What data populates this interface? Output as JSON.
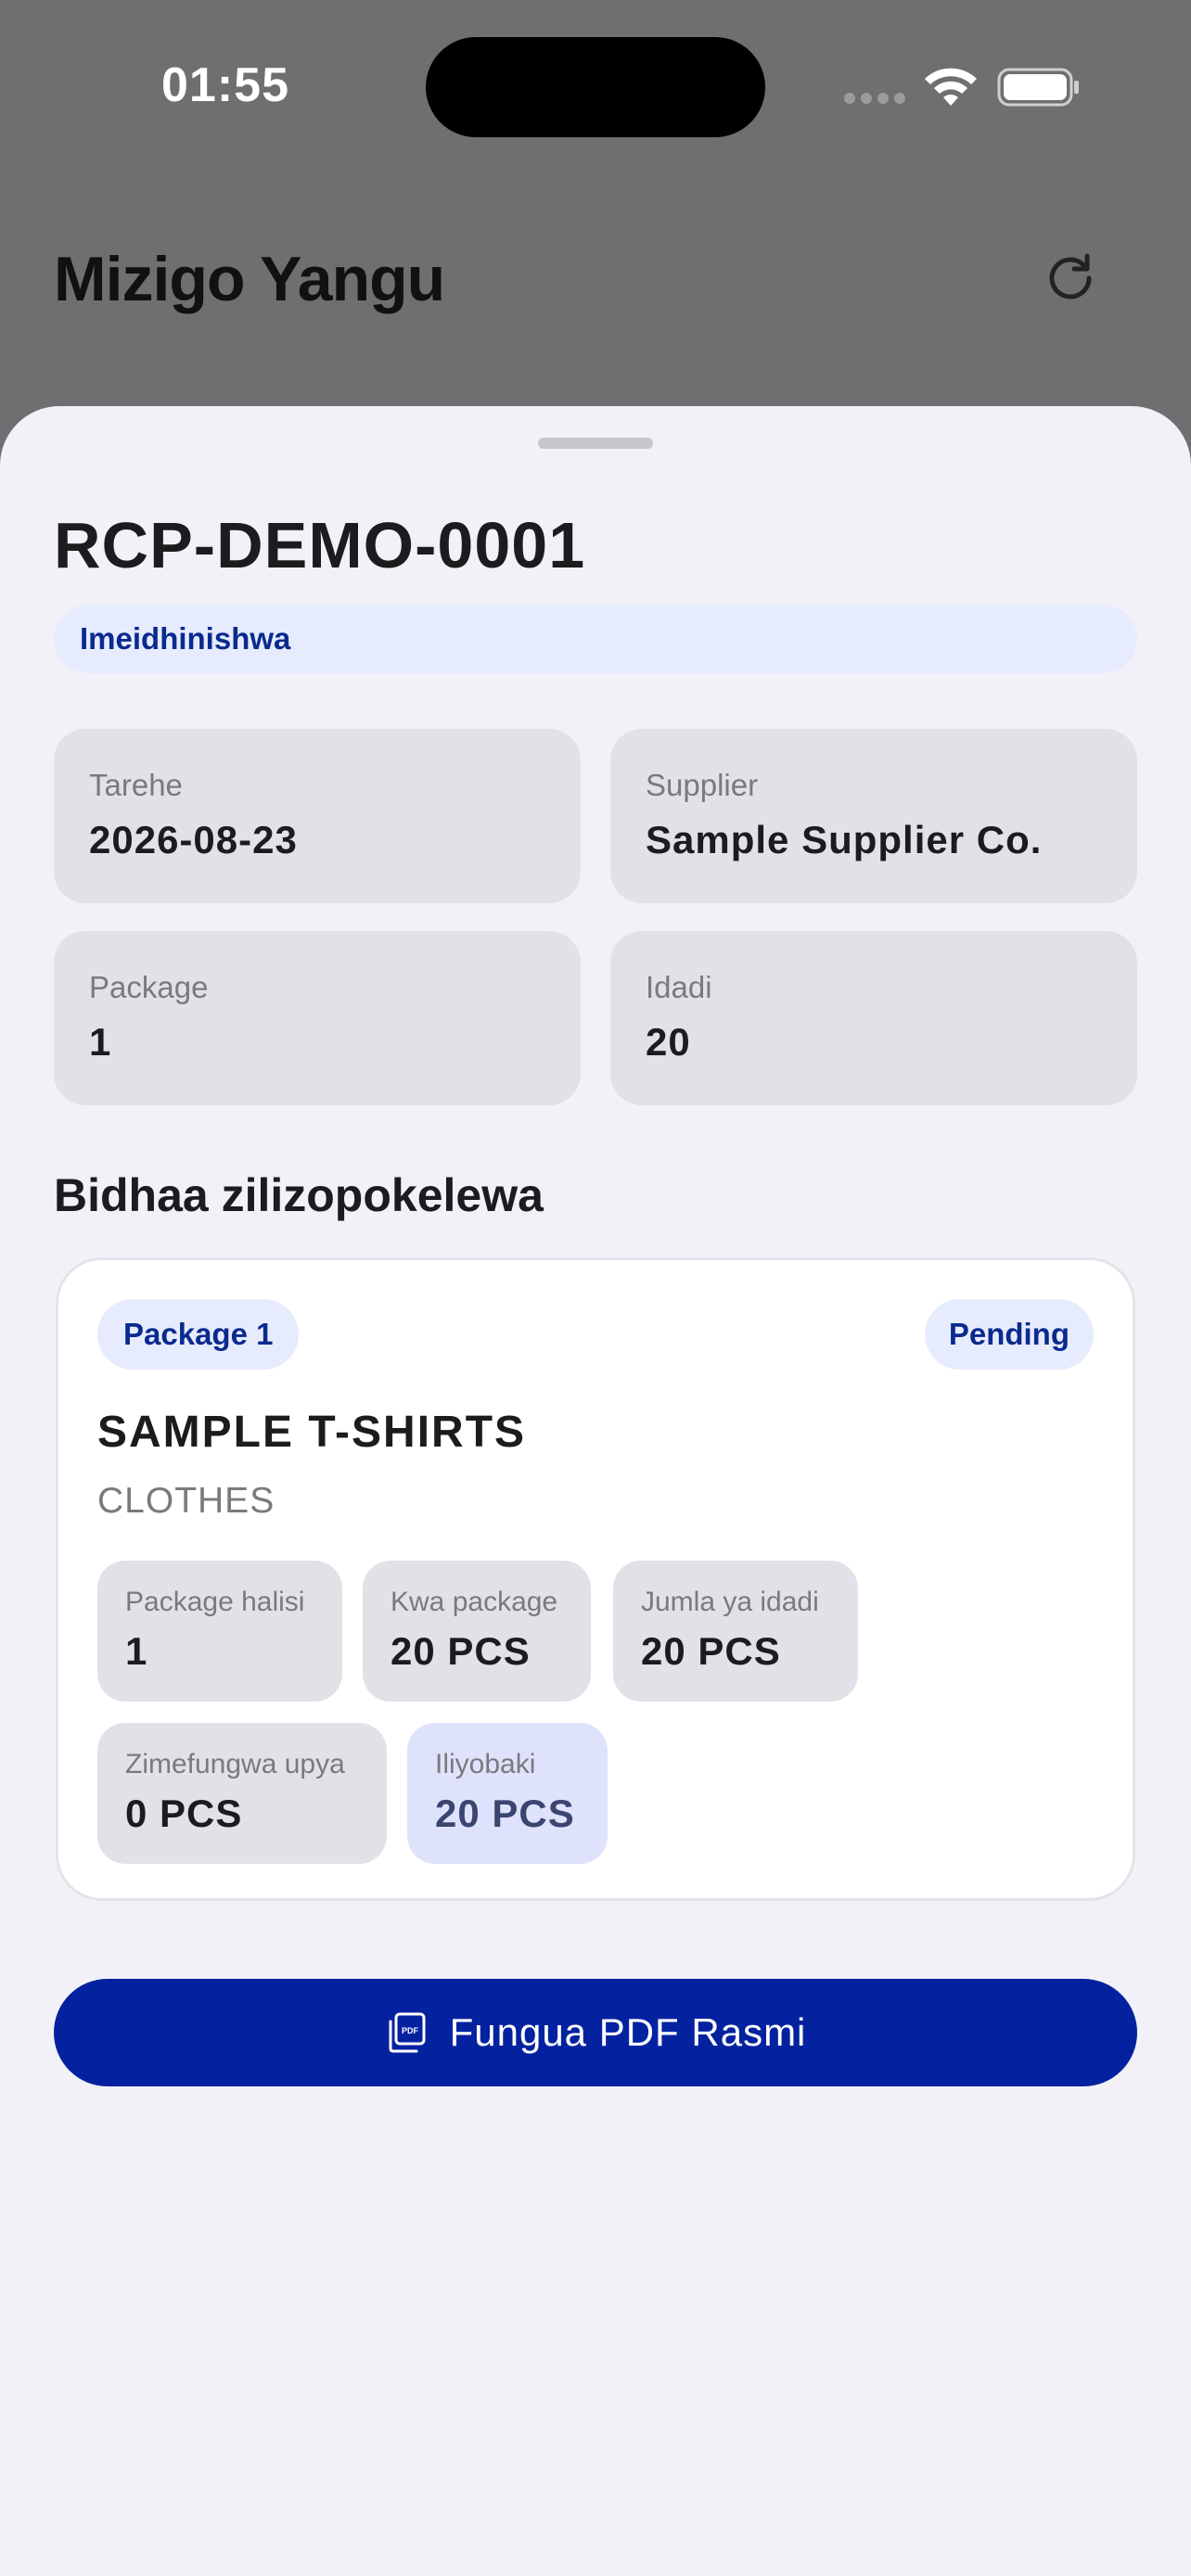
{
  "status_bar": {
    "time": "01:55"
  },
  "header": {
    "title": "Mizigo Yangu"
  },
  "receipt": {
    "number": "RCP-DEMO-0001",
    "status": "Imeidhinishwa"
  },
  "info": {
    "date_label": "Tarehe",
    "date_value": "2026-08-23",
    "supplier_label": "Supplier",
    "supplier_value": "Sample Supplier Co.",
    "package_label": "Package",
    "package_value": "1",
    "quantity_label": "Idadi",
    "quantity_value": "20"
  },
  "items_section": {
    "title": "Bidhaa zilizopokelewa",
    "item": {
      "package_tag": "Package 1",
      "status": "Pending",
      "name": "SAMPLE T-SHIRTS",
      "category": "CLOTHES",
      "stats": [
        {
          "label": "Package halisi",
          "value": "1"
        },
        {
          "label": "Kwa package",
          "value": "20 PCS"
        },
        {
          "label": "Jumla ya idadi",
          "value": "20 PCS"
        },
        {
          "label": "Zimefungwa upya",
          "value": "0 PCS"
        },
        {
          "label": "Iliyobaki",
          "value": "20 PCS"
        }
      ]
    }
  },
  "actions": {
    "open_pdf": "Fungua PDF Rasmi"
  },
  "colors": {
    "accent": "#0422a0",
    "pill_bg": "#e6ecfd",
    "pill_text": "#0a2a8f"
  }
}
